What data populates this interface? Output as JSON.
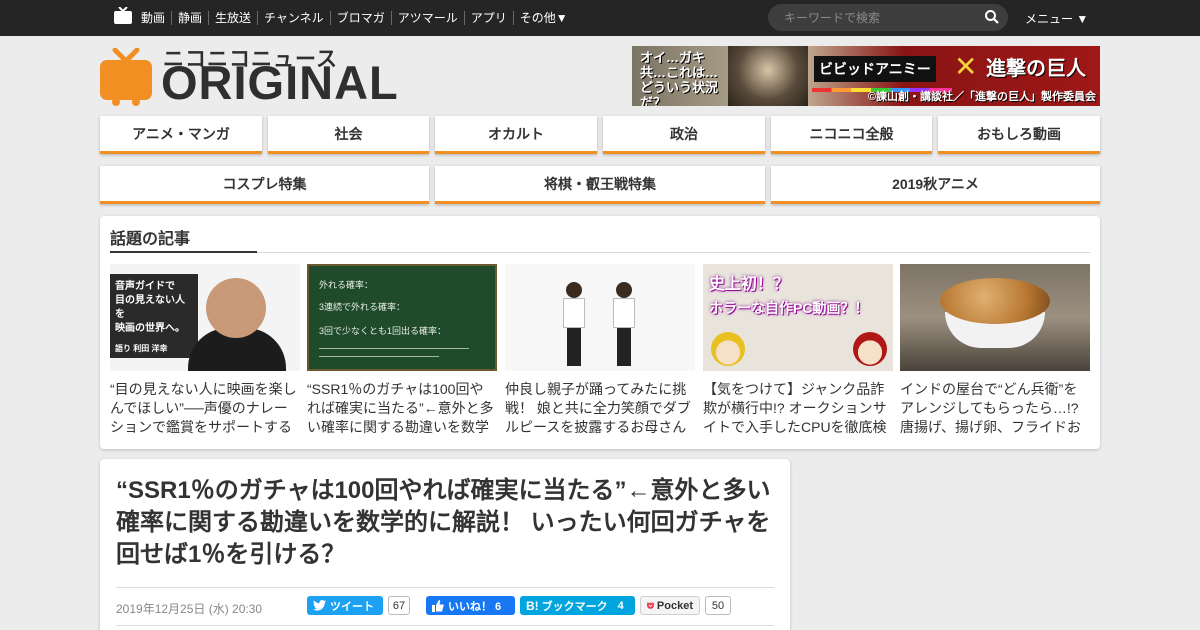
{
  "topbar": {
    "nav": [
      "動画",
      "静画",
      "生放送",
      "チャンネル",
      "ブロマガ",
      "アツマール",
      "アプリ",
      "その他▼"
    ],
    "search_placeholder": "キーワードで検索",
    "menu_label": "メニュー ▼"
  },
  "brand": {
    "kana": "ニコニコニュース",
    "name": "ORIGINAL",
    "accent_color": "#f28f23"
  },
  "banner": {
    "left_text": "オイ…ガキ共…これは…どういう状況だ？",
    "anime_label": "ビビッドアニミー",
    "cross": "✕",
    "title": "進撃の巨人",
    "copyright": "©諫山創・講談社／「進撃の巨人」製作委員会"
  },
  "categories_row1": [
    "アニメ・マンガ",
    "社会",
    "オカルト",
    "政治",
    "ニコニコ全般",
    "おもしろ動画"
  ],
  "categories_row2": [
    "コスプレ特集",
    "将棋・叡王戦特集",
    "2019秋アニメ"
  ],
  "trending": {
    "title": "話題の記事",
    "cards": [
      {
        "title": "“目の見えない人に映画を楽しんでほしい”──声優のナレーションで鑑賞をサポートする",
        "thumb_text": [
          "音声ガイドで",
          "目の見えない人を",
          "映画の世界へ。",
          "語り 利田 洋幸"
        ]
      },
      {
        "title": "“SSR1％のガチャは100回やれば確実に当たる”←意外と多い確率に関する勘違いを数学",
        "thumb_text": [
          "外れる確率：",
          "3連続で外れる確率：",
          "3回で少なくとも1回出る確率："
        ]
      },
      {
        "title": "仲良し親子が踊ってみたに挑戦！ 娘と共に全力笑顔でダブルピースを披露するお母さん",
        "thumb_text": []
      },
      {
        "title": "【気をつけて】ジャンク品詐欺が横行中!? オークションサイトで入手したCPUを徹底検",
        "thumb_text": [
          "史上初！？",
          "ホラーな自作PC動画？！"
        ]
      },
      {
        "title": "インドの屋台で“どん兵衛”をアレンジしてもらったら…!? 唐揚げ、揚げ卵、フライドお",
        "thumb_text": []
      }
    ]
  },
  "article": {
    "title": "“SSR1％のガチャは100回やれば確実に当たる”←意外と多い確率に関する勘違いを数学的に解説！ いったい何回ガチャを回せば1％を引ける？",
    "date": "2019年12月25日 (水) 20:30",
    "share": {
      "tweet_label": "ツイート",
      "tweet_count": "67",
      "like_label": "いいね！ 6",
      "hatena_label": "ブックマーク",
      "hatena_count": "4",
      "pocket_label": "Pocket",
      "pocket_count": "50"
    }
  }
}
